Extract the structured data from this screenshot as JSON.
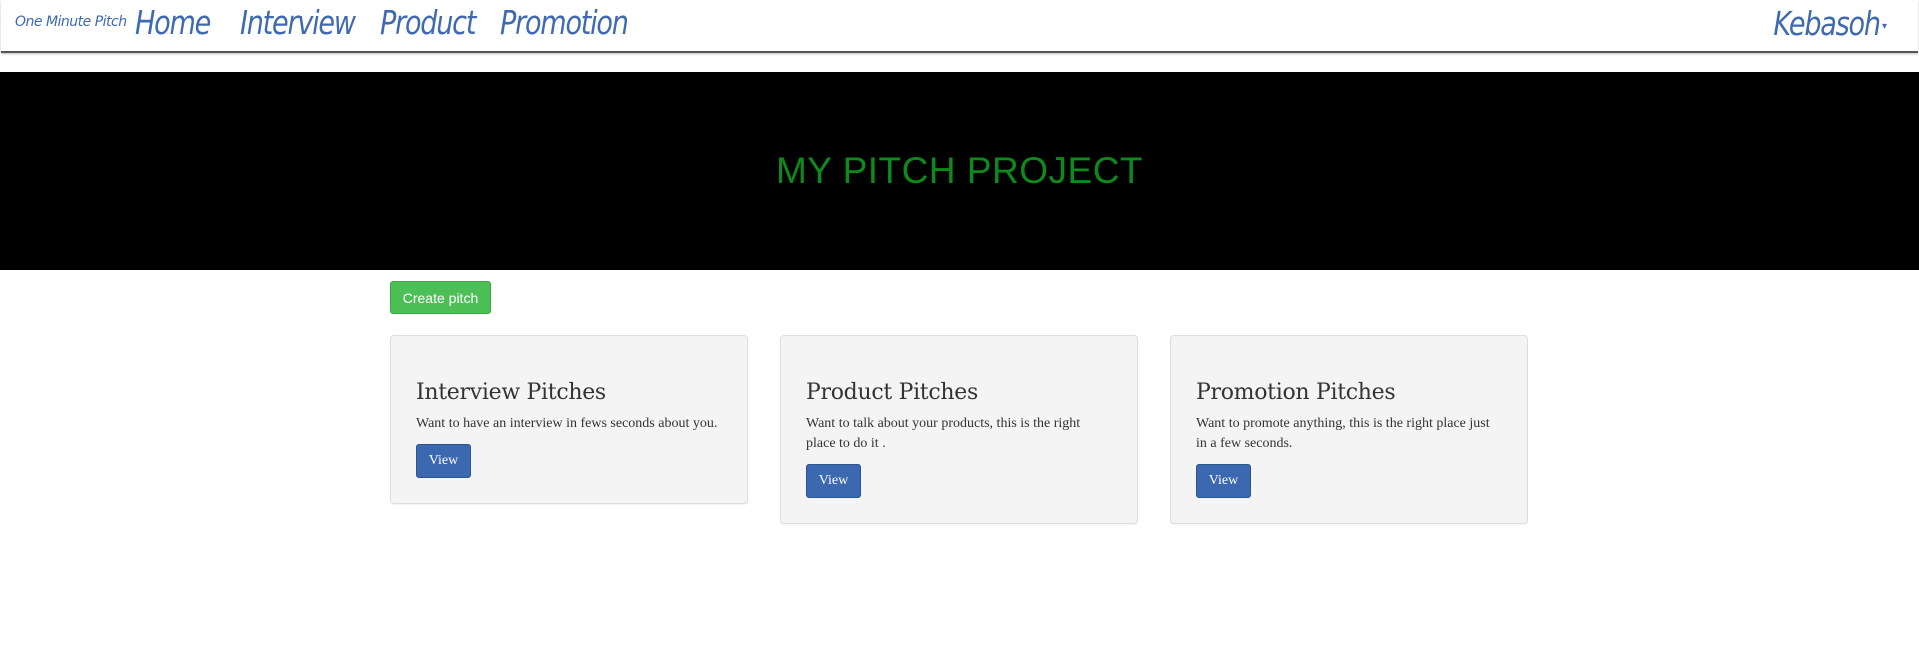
{
  "navbar": {
    "brand": "One Minute Pitch",
    "links": [
      "Home",
      "Interview",
      "Product",
      "Promotion"
    ],
    "user": "Kebasoh",
    "caret": "▾"
  },
  "hero": {
    "title": "MY PITCH PROJECT"
  },
  "actions": {
    "create_label": "Create pitch"
  },
  "cards": [
    {
      "title": "Interview Pitches",
      "text": "Want to have an interview in fews seconds about you.",
      "button": "View"
    },
    {
      "title": "Product Pitches",
      "text": "Want to talk about your products, this is the right place to do it .",
      "button": "View"
    },
    {
      "title": "Promotion Pitches",
      "text": "Want to promote anything, this is the right place just in a few seconds.",
      "button": "View"
    }
  ],
  "colors": {
    "nav_text": "#3f6ab1",
    "hero_bg": "#000000",
    "hero_text": "#0c8a1c",
    "create_button": "#4cbf56",
    "view_button": "#3b68ae",
    "card_bg": "#f4f4f4"
  }
}
